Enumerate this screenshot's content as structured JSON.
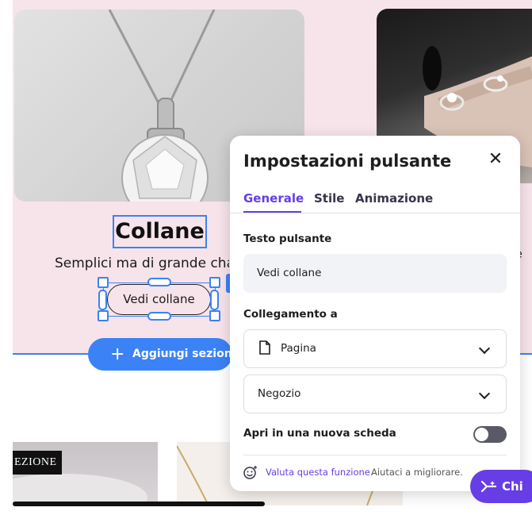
{
  "canvas": {
    "heading": "Collane",
    "subtitle": "Semplici ma di grande cha",
    "selected_button_label": "Vedi collane",
    "add_section_label": "Aggiungi sezione",
    "add_section_icon": "plus-icon",
    "bottom_label": "EZIONE",
    "side_char": "e"
  },
  "panel": {
    "title": "Impostazioni pulsante",
    "close_icon": "close-icon",
    "tabs": [
      {
        "label": "Generale",
        "active": true
      },
      {
        "label": "Stile",
        "active": false
      },
      {
        "label": "Animazione",
        "active": false
      }
    ],
    "button_text_label": "Testo pulsante",
    "button_text_value": "Vedi collane",
    "link_label": "Collegamento a",
    "link_type": {
      "icon": "page-icon",
      "value": "Pagina"
    },
    "link_target": {
      "value": "Negozio"
    },
    "new_tab_label": "Apri in una nuova scheda",
    "new_tab_enabled": false,
    "feedback_link": "Valuta questa funzione.",
    "feedback_text": "Aiutaci a migliorare."
  },
  "chat": {
    "label": "Chi",
    "icon": "ai-sparkle-icon"
  },
  "colors": {
    "accent": "#673de6",
    "selection": "#3b82f6",
    "section_bg": "#f7e4ea"
  }
}
